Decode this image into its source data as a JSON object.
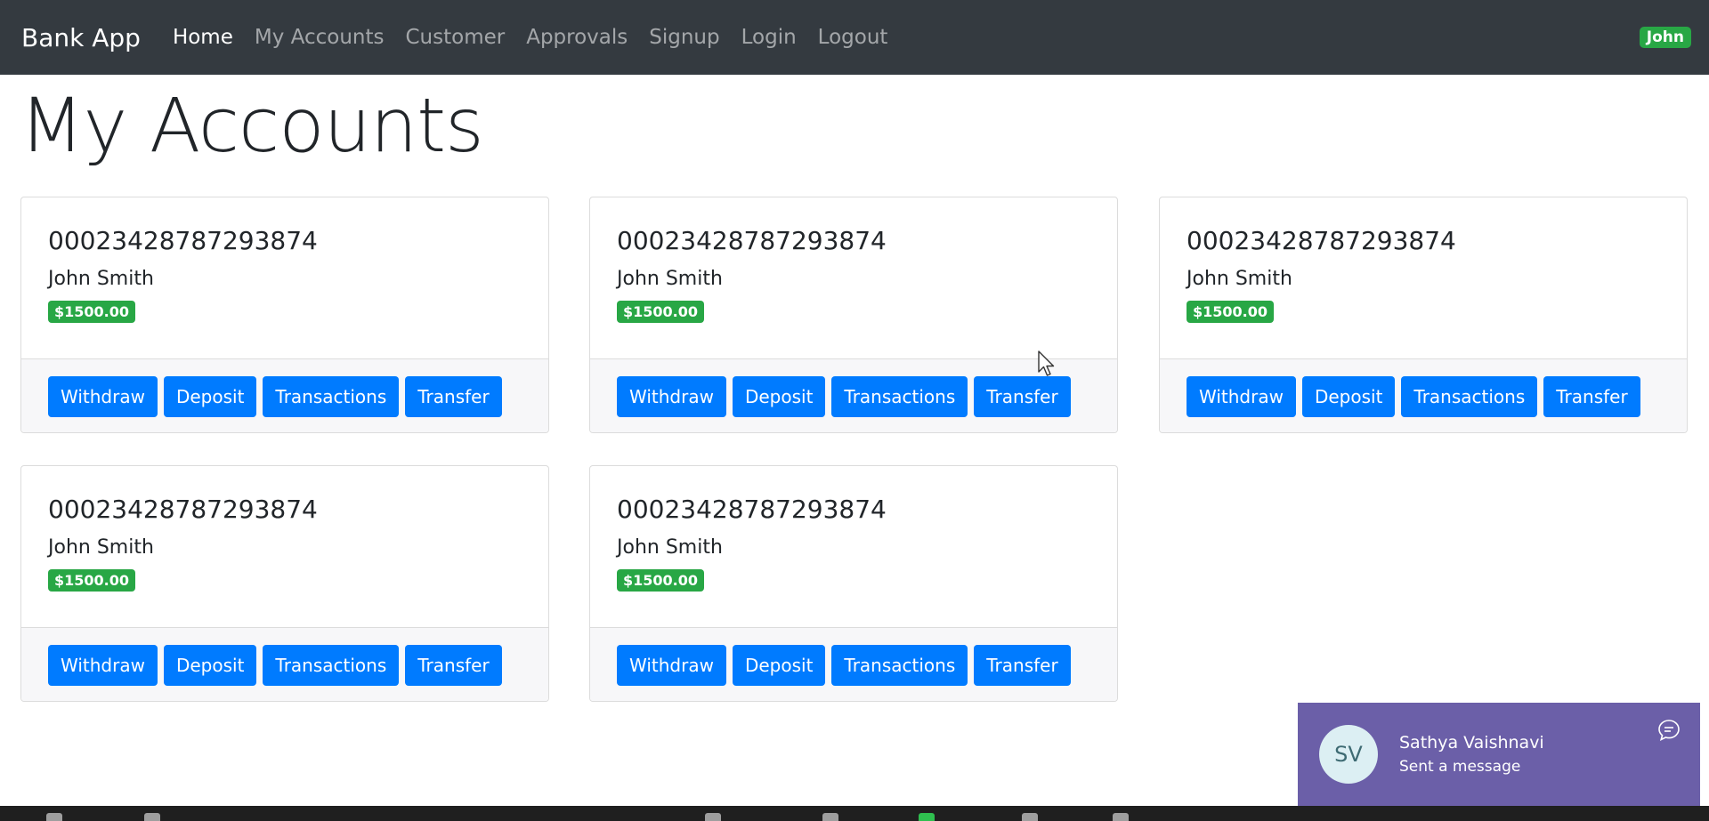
{
  "nav": {
    "brand": "Bank App",
    "links": [
      "Home",
      "My Accounts",
      "Customer",
      "Approvals",
      "Signup",
      "Login",
      "Logout"
    ],
    "user": "John"
  },
  "page": {
    "title": "My Accounts"
  },
  "buttons": {
    "withdraw": "Withdraw",
    "deposit": "Deposit",
    "transactions": "Transactions",
    "transfer": "Transfer"
  },
  "accounts": [
    {
      "number": "00023428787293874",
      "holder": "John Smith",
      "balance": "$1500.00"
    },
    {
      "number": "00023428787293874",
      "holder": "John Smith",
      "balance": "$1500.00"
    },
    {
      "number": "00023428787293874",
      "holder": "John Smith",
      "balance": "$1500.00"
    },
    {
      "number": "00023428787293874",
      "holder": "John Smith",
      "balance": "$1500.00"
    },
    {
      "number": "00023428787293874",
      "holder": "John Smith",
      "balance": "$1500.00"
    }
  ],
  "notification": {
    "initials": "SV",
    "name": "Sathya Vaishnavi",
    "message": "Sent a message"
  },
  "colors": {
    "navbar": "#343a40",
    "primary": "#007bff",
    "success": "#28a745",
    "toast": "#6b5fa8"
  }
}
